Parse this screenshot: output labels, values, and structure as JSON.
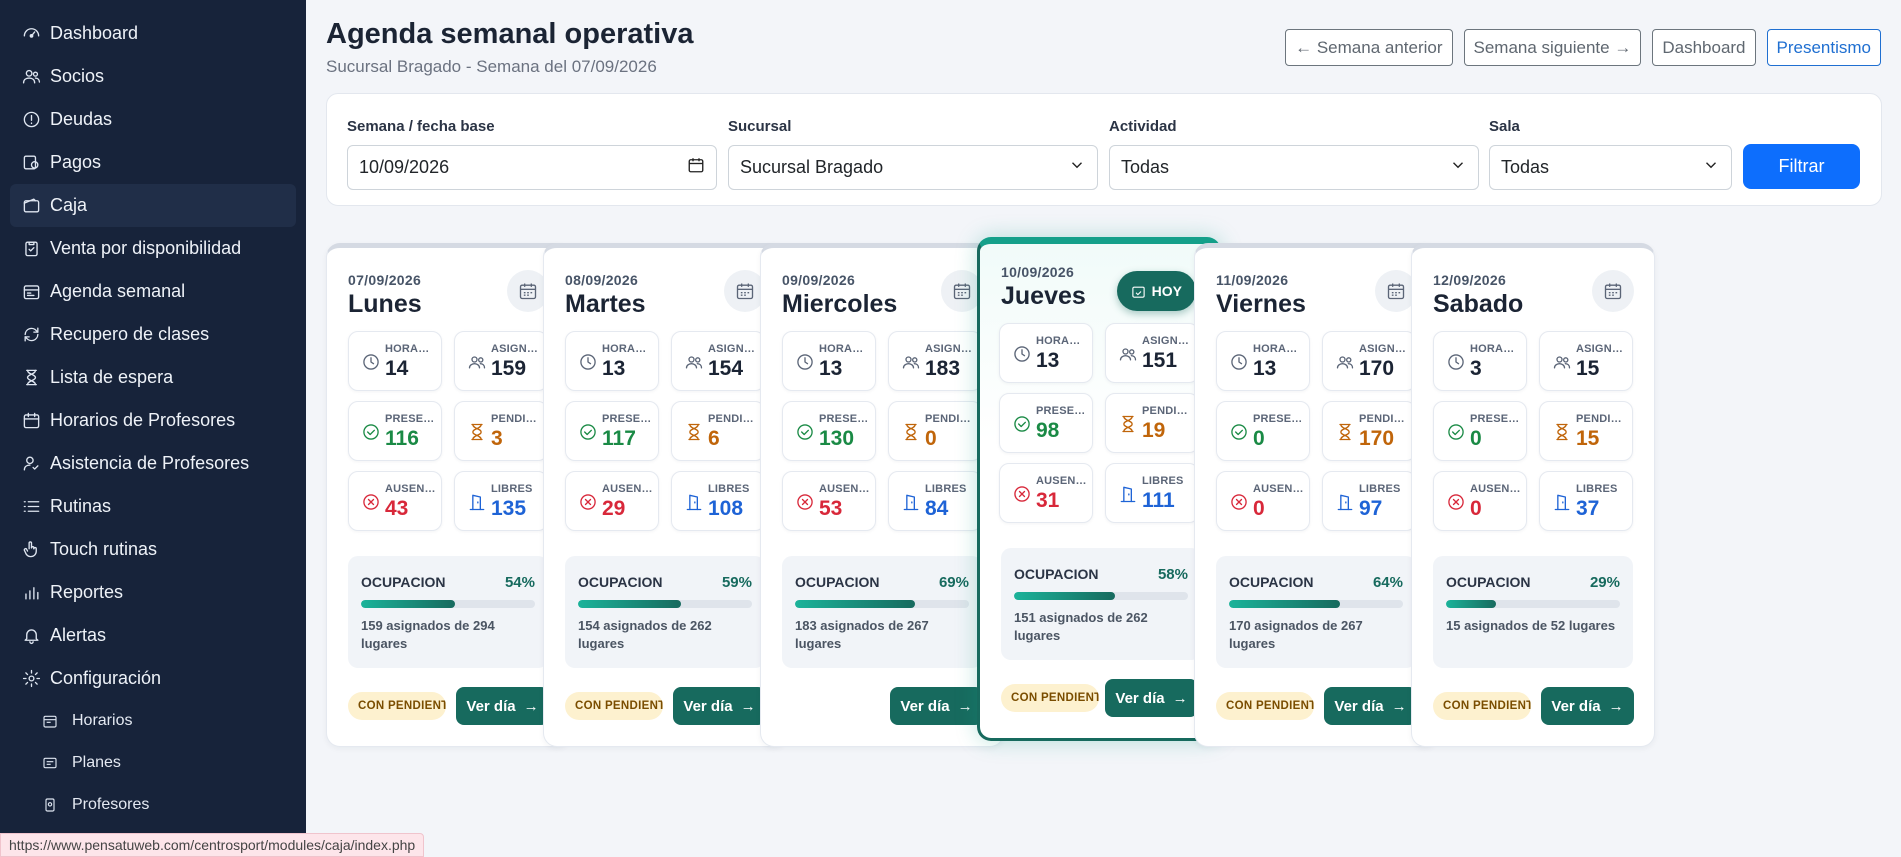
{
  "sidebar": {
    "items": [
      {
        "label": "Dashboard",
        "icon": "gauge-icon"
      },
      {
        "label": "Socios",
        "icon": "users-icon"
      },
      {
        "label": "Deudas",
        "icon": "alert-circle-icon"
      },
      {
        "label": "Pagos",
        "icon": "payments-icon"
      },
      {
        "label": "Caja",
        "icon": "wallet-icon",
        "active": true
      },
      {
        "label": "Venta por disponibilidad",
        "icon": "clipboard-check-icon"
      },
      {
        "label": "Agenda semanal",
        "icon": "calendar-week-icon"
      },
      {
        "label": "Recupero de clases",
        "icon": "refresh-icon"
      },
      {
        "label": "Lista de espera",
        "icon": "hourglass-icon"
      },
      {
        "label": "Horarios de Profesores",
        "icon": "calendar-icon"
      },
      {
        "label": "Asistencia de Profesores",
        "icon": "user-check-icon"
      },
      {
        "label": "Rutinas",
        "icon": "list-icon"
      },
      {
        "label": "Touch rutinas",
        "icon": "hand-pointer-icon"
      },
      {
        "label": "Reportes",
        "icon": "bar-chart-icon"
      },
      {
        "label": "Alertas",
        "icon": "bell-icon"
      },
      {
        "label": "Configuración",
        "icon": "gear-icon"
      }
    ],
    "subitems": [
      {
        "label": "Horarios",
        "icon": "calendar-small-icon"
      },
      {
        "label": "Planes",
        "icon": "card-icon"
      },
      {
        "label": "Profesores",
        "icon": "badge-icon"
      }
    ]
  },
  "status_url": "https://www.pensatuweb.com/centrosport/modules/caja/index.php",
  "header": {
    "title": "Agenda semanal operativa",
    "subtitle": "Sucursal Bragado - Semana del 07/09/2026",
    "buttons": {
      "prev": "← Semana anterior",
      "next": "Semana siguiente →",
      "dashboard": "Dashboard",
      "presentismo": "Presentismo"
    }
  },
  "filters": {
    "week_label": "Semana / fecha base",
    "week_value": "10/09/2026",
    "branch_label": "Sucursal",
    "branch_value": "Sucursal Bragado",
    "activity_label": "Actividad",
    "activity_value": "Todas",
    "room_label": "Sala",
    "room_value": "Todas",
    "submit_label": "Filtrar"
  },
  "labels": {
    "horarios": "HORARIOS",
    "asignados": "ASIGNADOS",
    "presentes": "PRESENTES",
    "pendientes": "PENDIENTES",
    "ausentes": "AUSENTES",
    "libres": "LIBRES",
    "ocupacion": "OCUPACION",
    "pending_badge": "CON PENDIENTES",
    "ver_dia": "Ver día",
    "hoy": "HOY"
  },
  "colors": {
    "accent": "#176a5e",
    "primary": "#0d6efd",
    "present": "#1a8a45",
    "pending": "#c0650a",
    "absent": "#d8283a",
    "free": "#1e63d6"
  },
  "days": [
    {
      "date": "07/09/2026",
      "name": "Lunes",
      "horarios": "14",
      "asignados": "159",
      "presentes": "116",
      "pendientes": "3",
      "ausentes": "43",
      "libres": "135",
      "ocupacion_pct": "54%",
      "ocupacion_value": 54,
      "ocupacion_text": "159 asignados de 294 lugares",
      "pendientes_flag": true,
      "today": false
    },
    {
      "date": "08/09/2026",
      "name": "Martes",
      "horarios": "13",
      "asignados": "154",
      "presentes": "117",
      "pendientes": "6",
      "ausentes": "29",
      "libres": "108",
      "ocupacion_pct": "59%",
      "ocupacion_value": 59,
      "ocupacion_text": "154 asignados de 262 lugares",
      "pendientes_flag": true,
      "today": false
    },
    {
      "date": "09/09/2026",
      "name": "Miercoles",
      "horarios": "13",
      "asignados": "183",
      "presentes": "130",
      "pendientes": "0",
      "ausentes": "53",
      "libres": "84",
      "ocupacion_pct": "69%",
      "ocupacion_value": 69,
      "ocupacion_text": "183 asignados de 267 lugares",
      "pendientes_flag": false,
      "today": false
    },
    {
      "date": "10/09/2026",
      "name": "Jueves",
      "horarios": "13",
      "asignados": "151",
      "presentes": "98",
      "pendientes": "19",
      "ausentes": "31",
      "libres": "111",
      "ocupacion_pct": "58%",
      "ocupacion_value": 58,
      "ocupacion_text": "151 asignados de 262 lugares",
      "pendientes_flag": true,
      "today": true
    },
    {
      "date": "11/09/2026",
      "name": "Viernes",
      "horarios": "13",
      "asignados": "170",
      "presentes": "0",
      "pendientes": "170",
      "ausentes": "0",
      "libres": "97",
      "ocupacion_pct": "64%",
      "ocupacion_value": 64,
      "ocupacion_text": "170 asignados de 267 lugares",
      "pendientes_flag": true,
      "today": false
    },
    {
      "date": "12/09/2026",
      "name": "Sabado",
      "horarios": "3",
      "asignados": "15",
      "presentes": "0",
      "pendientes": "15",
      "ausentes": "0",
      "libres": "37",
      "ocupacion_pct": "29%",
      "ocupacion_value": 29,
      "ocupacion_text": "15 asignados de 52 lugares",
      "pendientes_flag": true,
      "today": false
    }
  ]
}
